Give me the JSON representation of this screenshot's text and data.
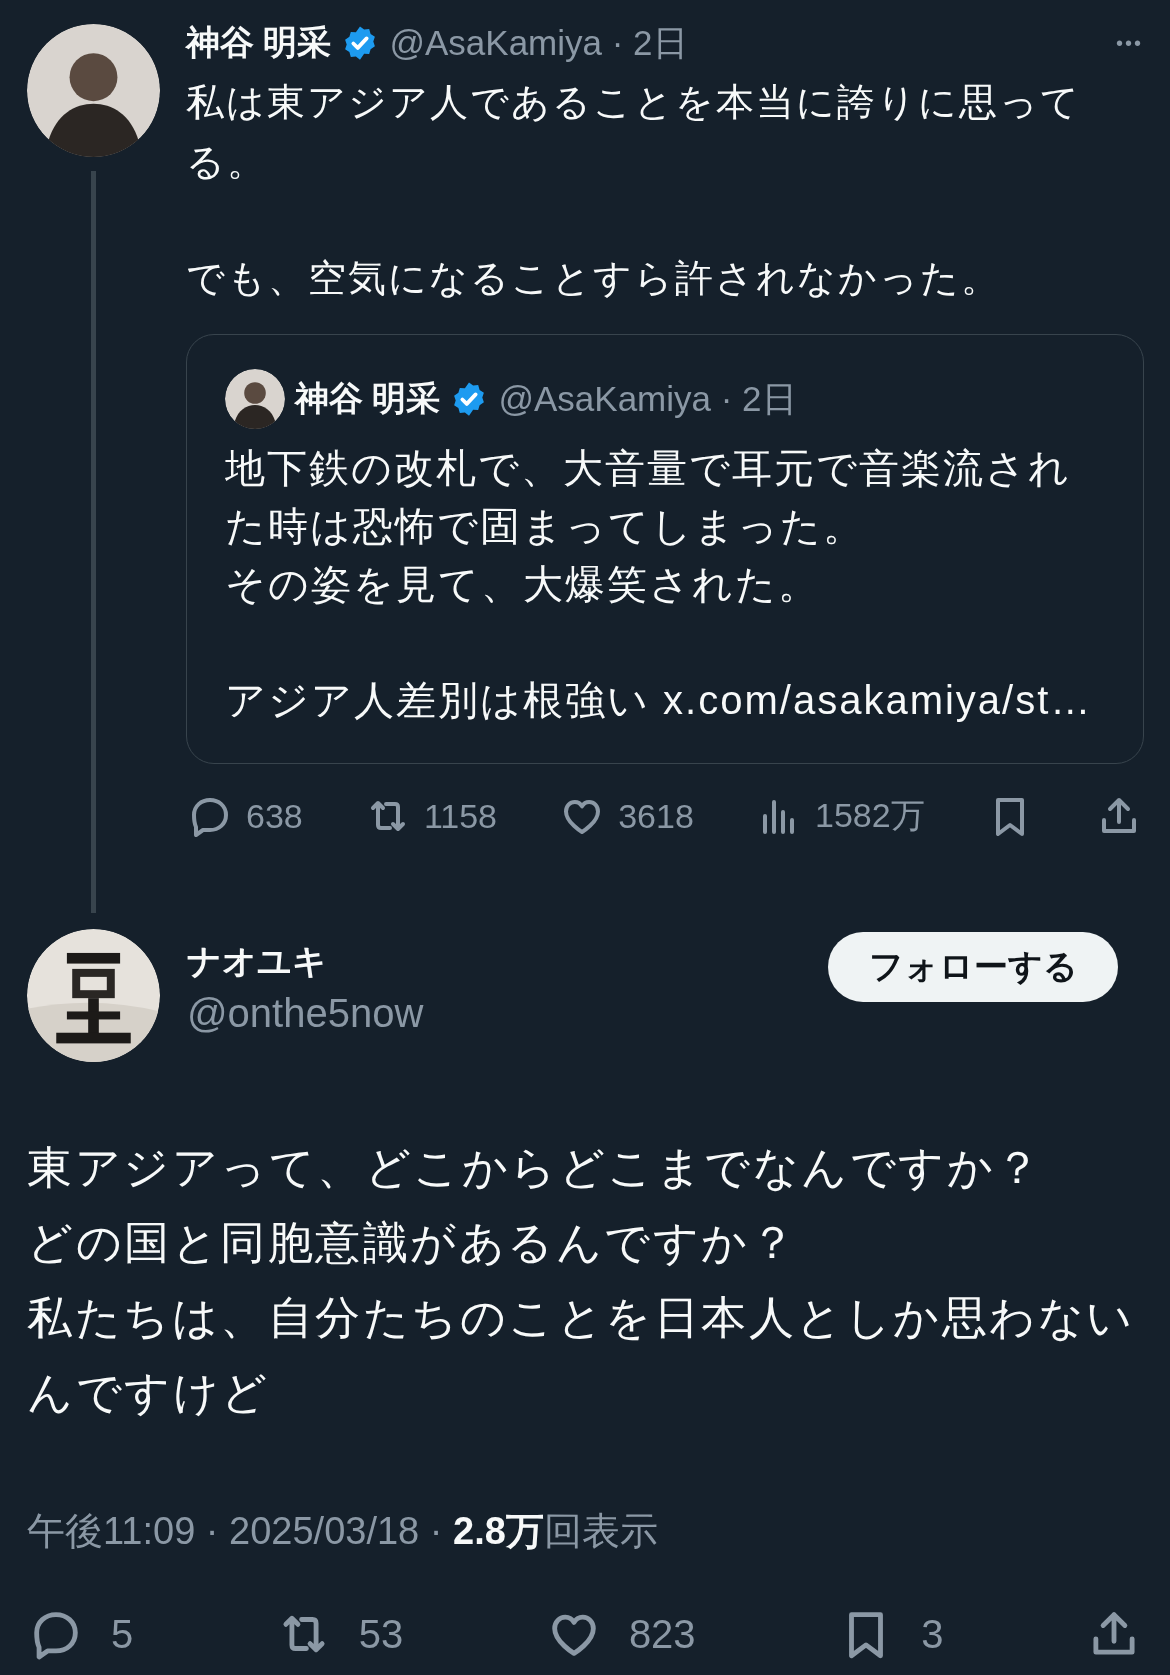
{
  "parent_tweet": {
    "name": "神谷 明采",
    "verified": true,
    "meta": "@AsaKamiya · 2日",
    "more": "•••",
    "paragraphs": [
      "私は東アジア人であることを本当に誇りに思ってる。",
      "でも、空気になることすら許されなかった。"
    ],
    "quote": {
      "name": "神谷 明采",
      "verified": true,
      "meta": "@AsaKamiya · 2日",
      "paragraphs": [
        [
          "地下鉄の改札で、大音量で耳元で音楽流された時は恐怖で固まってしまった。",
          "その姿を見て、大爆笑された。"
        ],
        [
          "アジア人差別は根強い x.com/asakamiya/st…"
        ]
      ]
    },
    "actions": [
      {
        "kind": "reply",
        "count": "638"
      },
      {
        "kind": "retweet",
        "count": "1158"
      },
      {
        "kind": "like",
        "count": "3618"
      },
      {
        "kind": "views",
        "count": "1582万"
      },
      {
        "kind": "bookmark"
      },
      {
        "kind": "share"
      }
    ]
  },
  "reply_tweet": {
    "name": "ナオユキ",
    "handle": "@onthe5now",
    "follow_button": "フォローする",
    "text": [
      "東アジアって、どこからどこまでなんですか？",
      "どの国と同胞意識があるんですか？",
      "私たちは、自分たちのことを日本人としか思わないんですけど"
    ],
    "meta": "午後11:09 · 2025/03/18 · **2.8万**回表示",
    "actions": [
      {
        "kind": "reply",
        "count": "5"
      },
      {
        "kind": "retweet",
        "count": "53"
      },
      {
        "kind": "like",
        "count": "823"
      },
      {
        "kind": "bookmark",
        "count": "3"
      },
      {
        "kind": "share"
      }
    ]
  }
}
